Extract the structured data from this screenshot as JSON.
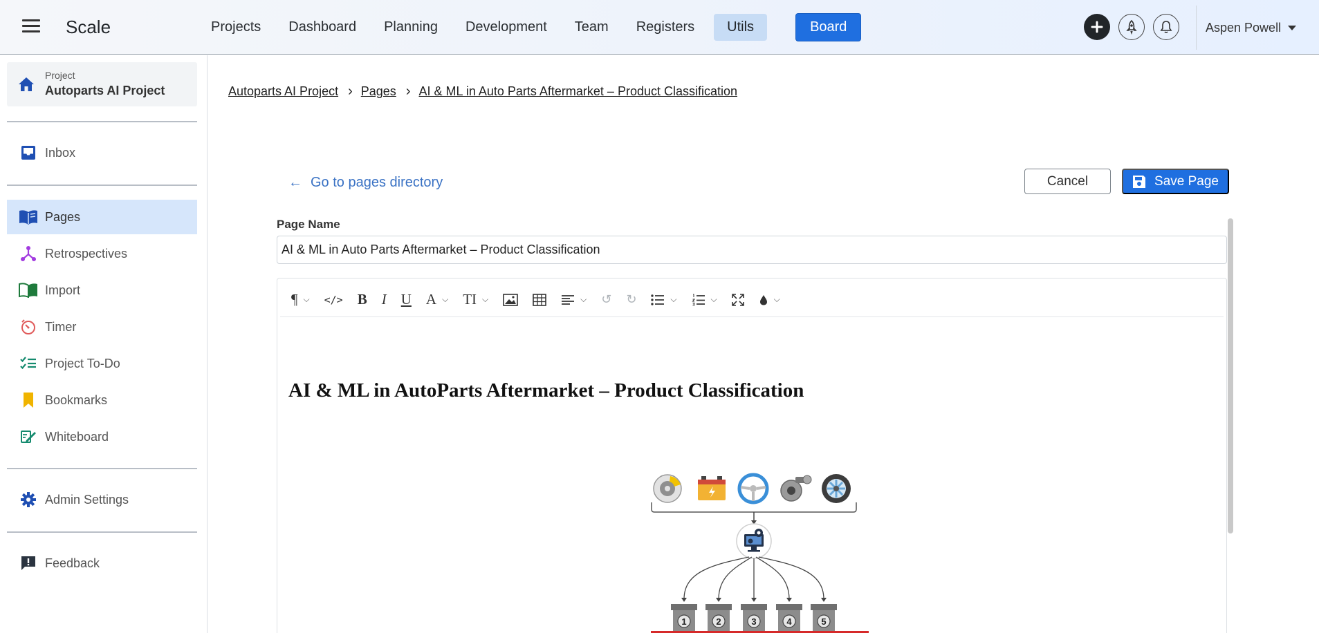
{
  "app": {
    "brand": "Scale"
  },
  "nav": {
    "items": [
      "Projects",
      "Dashboard",
      "Planning",
      "Development",
      "Team",
      "Registers"
    ],
    "utils": "Utils",
    "board": "Board"
  },
  "user": {
    "name": "Aspen Powell"
  },
  "icons": {
    "menu": "hamburger-icon",
    "add": "plus-circle-icon",
    "rocket": "rocket-icon",
    "bell": "bell-icon",
    "home": "home-icon",
    "save": "floppy-disk-icon"
  },
  "sidebar": {
    "project_label": "Project",
    "project_name": "Autoparts AI Project",
    "inbox": "Inbox",
    "pages": "Pages",
    "retrospectives": "Retrospectives",
    "import": "Import",
    "timer": "Timer",
    "todo": "Project To-Do",
    "bookmarks": "Bookmarks",
    "whiteboard": "Whiteboard",
    "admin": "Admin Settings",
    "feedback": "Feedback"
  },
  "breadcrumb": {
    "project": "Autoparts AI Project",
    "pages": "Pages",
    "current": "AI & ML in Auto Parts Aftermarket – Product Classification"
  },
  "actions": {
    "back": "Go to pages directory",
    "cancel": "Cancel",
    "save": "Save Page"
  },
  "form": {
    "page_name_label": "Page Name",
    "page_name_value": "AI & ML in Auto Parts Aftermarket – Product Classification"
  },
  "editor": {
    "doc_title": "AI & ML in AutoParts Aftermarket – Product Classification",
    "bin_numbers": [
      "1",
      "2",
      "3",
      "4",
      "5"
    ]
  },
  "colors": {
    "accent": "#1f6fe0",
    "sidebar_active": "#d6e6fb",
    "link": "#3a72c4"
  }
}
